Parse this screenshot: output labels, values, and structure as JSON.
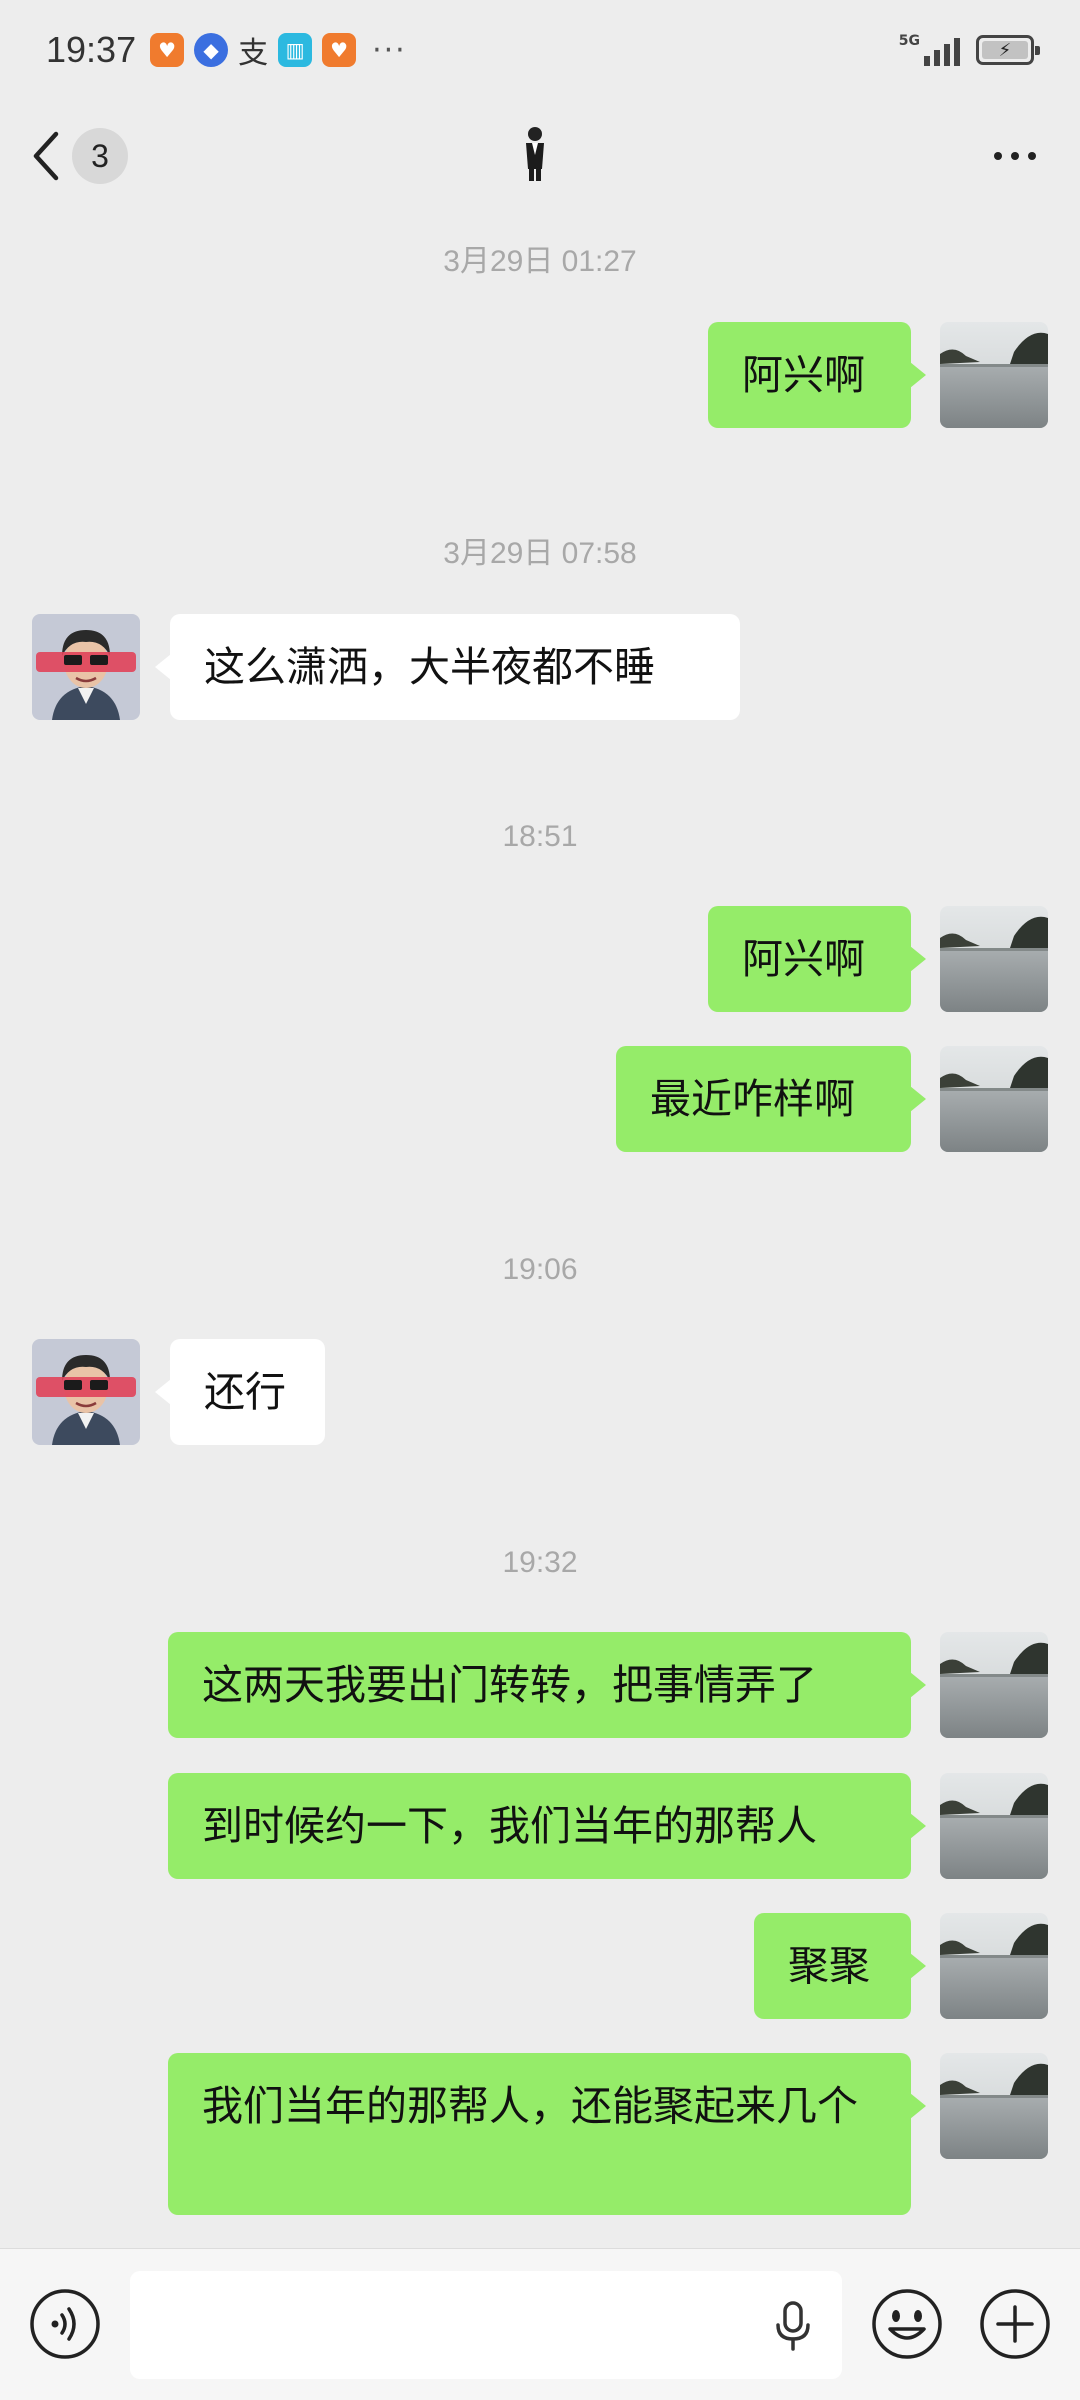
{
  "status_bar": {
    "time": "19:37",
    "network": "5G",
    "more_indicator": "···"
  },
  "header": {
    "unread_count": "3",
    "title_icon": "person-in-suit-emoji",
    "menu_icon": "more-dots-icon"
  },
  "messages": [
    {
      "kind": "timestamp",
      "text": "3月29日 01:27"
    },
    {
      "kind": "msg",
      "side": "me",
      "text": "阿兴啊"
    },
    {
      "kind": "timestamp",
      "text": "3月29日 07:58"
    },
    {
      "kind": "msg",
      "side": "them",
      "text": "这么潇洒，大半夜都不睡"
    },
    {
      "kind": "timestamp",
      "text": "18:51"
    },
    {
      "kind": "msg",
      "side": "me",
      "text": "阿兴啊"
    },
    {
      "kind": "msg",
      "side": "me",
      "text": "最近咋样啊"
    },
    {
      "kind": "timestamp",
      "text": "19:06"
    },
    {
      "kind": "msg",
      "side": "them",
      "text": "还行"
    },
    {
      "kind": "timestamp",
      "text": "19:32"
    },
    {
      "kind": "msg",
      "side": "me",
      "text": "这两天我要出门转转，把事情弄了"
    },
    {
      "kind": "msg",
      "side": "me",
      "text": "到时候约一下，我们当年的那帮人"
    },
    {
      "kind": "msg",
      "side": "me",
      "text": "聚聚"
    },
    {
      "kind": "msg",
      "side": "me",
      "text": "我们当年的那帮人，还能聚起来几个"
    }
  ],
  "input_bar": {
    "input_value": "",
    "icons": [
      "voice-icon",
      "mic-icon",
      "emoji-icon",
      "plus-icon"
    ]
  },
  "colors": {
    "background": "#ededed",
    "my_bubble": "#95ec69",
    "their_bubble": "#ffffff",
    "timestamp": "#a8a8a8"
  }
}
